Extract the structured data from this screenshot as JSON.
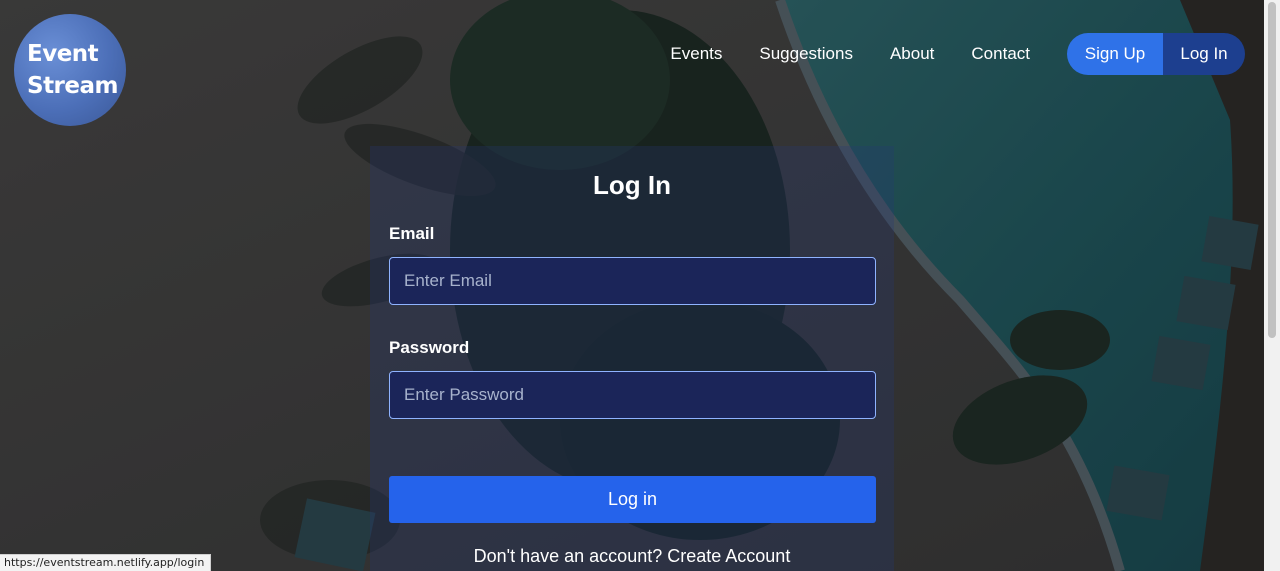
{
  "brand": {
    "line1": "Event",
    "line2": "Stream"
  },
  "nav": {
    "links": [
      "Events",
      "Suggestions",
      "About",
      "Contact"
    ],
    "signup_label": "Sign Up",
    "login_label": "Log In"
  },
  "login_form": {
    "title": "Log In",
    "email_label": "Email",
    "email_placeholder": "Enter Email",
    "password_label": "Password",
    "password_placeholder": "Enter Password",
    "submit_label": "Log in",
    "signup_prompt": "Don't have an account?",
    "signup_link": "Create Account"
  },
  "status_bar": {
    "url": "https://eventstream.netlify.app/login"
  },
  "colors": {
    "primary_button": "#2563eb",
    "signup_button": "#2f72e8",
    "login_nav_button": "#1d3f8f",
    "input_bg": "#1b2559",
    "input_border": "#8fb3ff"
  }
}
